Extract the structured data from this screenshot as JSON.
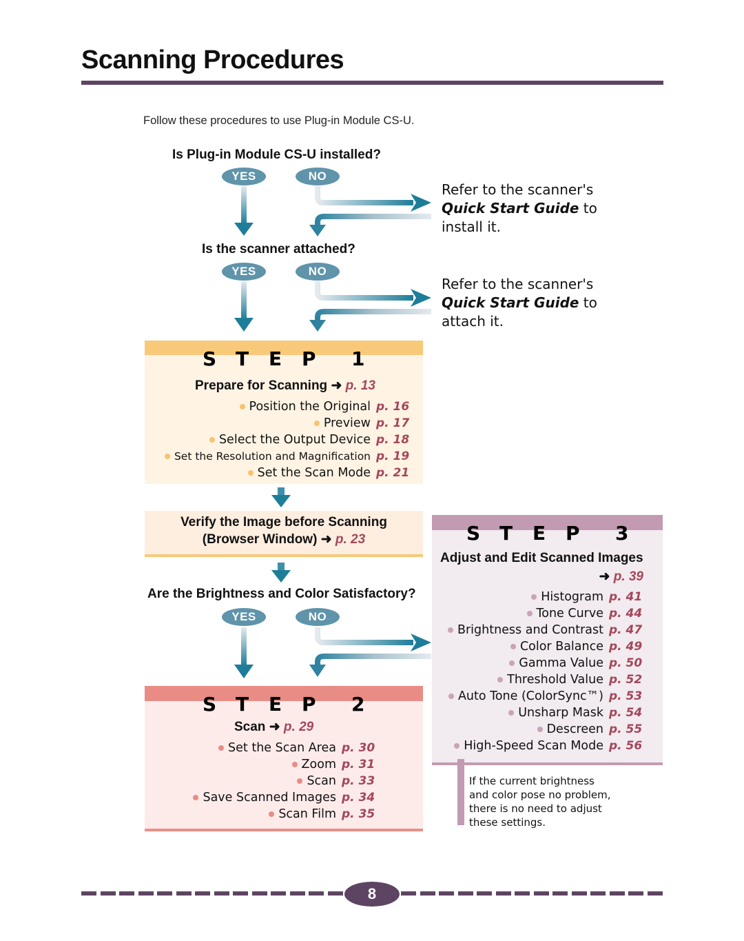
{
  "header": {
    "title": "Scanning Procedures",
    "intro": "Follow these procedures to use Plug-in Module CS-U."
  },
  "flow": {
    "q1": "Is Plug-in Module CS-U installed?",
    "q2": "Is the scanner attached?",
    "q3": "Are the Brightness and Color Satisfactory?",
    "yes": "YES",
    "no": "NO",
    "refer1": {
      "line1": "Refer to the scanner's",
      "guide": "Quick Start Guide",
      "to": " to",
      "line3": "install it."
    },
    "refer2": {
      "line1": "Refer to the scanner's",
      "guide": "Quick Start Guide",
      "to": " to",
      "line3": "attach it."
    },
    "arrow_color": "#1e7d99"
  },
  "step1": {
    "letters": [
      "S",
      "T",
      "E",
      "P",
      "1"
    ],
    "heading": "Prepare for Scanning",
    "arrow": "➜",
    "page": "p. 13",
    "color_band": "#f9c97a",
    "color_dot": "#f7c36e",
    "items": [
      {
        "label": "Position the Original",
        "page": "p. 16"
      },
      {
        "label": "Preview",
        "page": "p. 17"
      },
      {
        "label": "Select the Output Device",
        "page": "p. 18"
      },
      {
        "label": "Set the Resolution and Magnification",
        "page": "p. 19"
      },
      {
        "label": "Set the Scan Mode",
        "page": "p. 21"
      }
    ]
  },
  "verify": {
    "line1": "Verify the Image before Scanning",
    "line2": "(Browser Window)",
    "arrow": "➜",
    "page": "p. 23"
  },
  "step2": {
    "letters": [
      "S",
      "T",
      "E",
      "P",
      "2"
    ],
    "heading": "Scan",
    "arrow": "➜",
    "page": "p. 29",
    "color_band": "#e98c85",
    "color_dot": "#e98c85",
    "items": [
      {
        "label": "Set the Scan Area",
        "page": "p. 30"
      },
      {
        "label": "Zoom",
        "page": "p. 31"
      },
      {
        "label": "Scan",
        "page": "p. 33"
      },
      {
        "label": "Save Scanned Images",
        "page": "p. 34"
      },
      {
        "label": "Scan Film",
        "page": "p. 35"
      }
    ]
  },
  "step3": {
    "letters": [
      "S",
      "T",
      "E",
      "P",
      "3"
    ],
    "heading": "Adjust and Edit Scanned Images",
    "arrow": "➜",
    "page": "p. 39",
    "color_band": "#c29ab2",
    "color_dot": "#c9a3b9",
    "items": [
      {
        "label": "Histogram",
        "page": "p. 41"
      },
      {
        "label": "Tone Curve",
        "page": "p. 44"
      },
      {
        "label": "Brightness and Contrast",
        "page": "p. 47"
      },
      {
        "label": "Color Balance",
        "page": "p. 49"
      },
      {
        "label": "Gamma Value",
        "page": "p. 50"
      },
      {
        "label": "Threshold Value",
        "page": "p. 52"
      },
      {
        "label": "Auto Tone (ColorSync™)",
        "page": "p. 53"
      },
      {
        "label": "Unsharp Mask",
        "page": "p. 54"
      },
      {
        "label": "Descreen",
        "page": "p. 55"
      },
      {
        "label": "High-Speed Scan Mode",
        "page": "p. 56"
      }
    ],
    "note": [
      "If the current brightness",
      "and color pose no problem,",
      "there is no need to adjust",
      "these settings."
    ]
  },
  "footer": {
    "page_number": "8",
    "accent": "#5e4463"
  }
}
